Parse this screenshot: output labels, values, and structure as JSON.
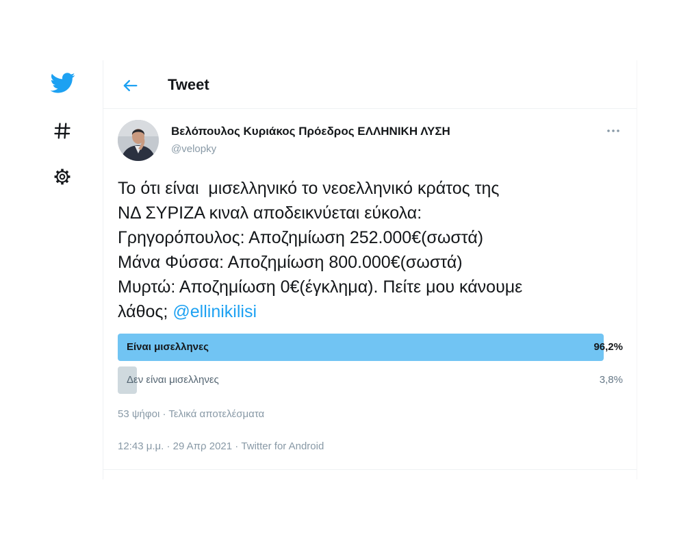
{
  "colors": {
    "accent": "#1da1f2",
    "poll_leading": "#71c4f3",
    "poll_other": "#cfd9de",
    "muted": "#8899a6",
    "text": "#14171a"
  },
  "sidebar": {
    "icons": [
      "twitter-bird-icon",
      "hashtag-icon",
      "settings-gear-icon"
    ]
  },
  "header": {
    "back_icon": "arrow-left-icon",
    "title": "Tweet"
  },
  "tweet": {
    "author": {
      "name": "Βελόπουλος Κυριάκος Πρόεδρος ΕΛΛΗΝΙΚΗ ΛΥΣΗ",
      "handle": "@velopky"
    },
    "more_icon": "more-horizontal-icon",
    "text_lines": [
      "Το ότι είναι  μισελληνικό το νεοελληνικό κράτος της",
      "ΝΔ ΣΥΡΙΖΑ κιναλ αποδεικνύεται εύκολα:",
      "Γρηγορόπουλος: Αποζημίωση 252.000€(σωστά)",
      "Μάνα Φύσσα: Αποζημίωση 800.000€(σωστά)",
      "Μυρτώ: Αποζημίωση 0€(έγκλημα). Πείτε μου κάνουμε"
    ],
    "last_line": "λάθος;",
    "mention": "@ellinikilisi",
    "poll": {
      "options": [
        {
          "label": "Είναι μισελληνες",
          "percent_label": "96,2%",
          "percent": 96.2
        },
        {
          "label": "Δεν είναι μισελληνες",
          "percent_label": "3,8%",
          "percent": 3.8
        }
      ],
      "summary": "53 ψήφοι · Τελικά αποτελέσματα"
    },
    "meta": "12:43 μ.μ. · 29 Απρ 2021 · Twitter for Android"
  }
}
